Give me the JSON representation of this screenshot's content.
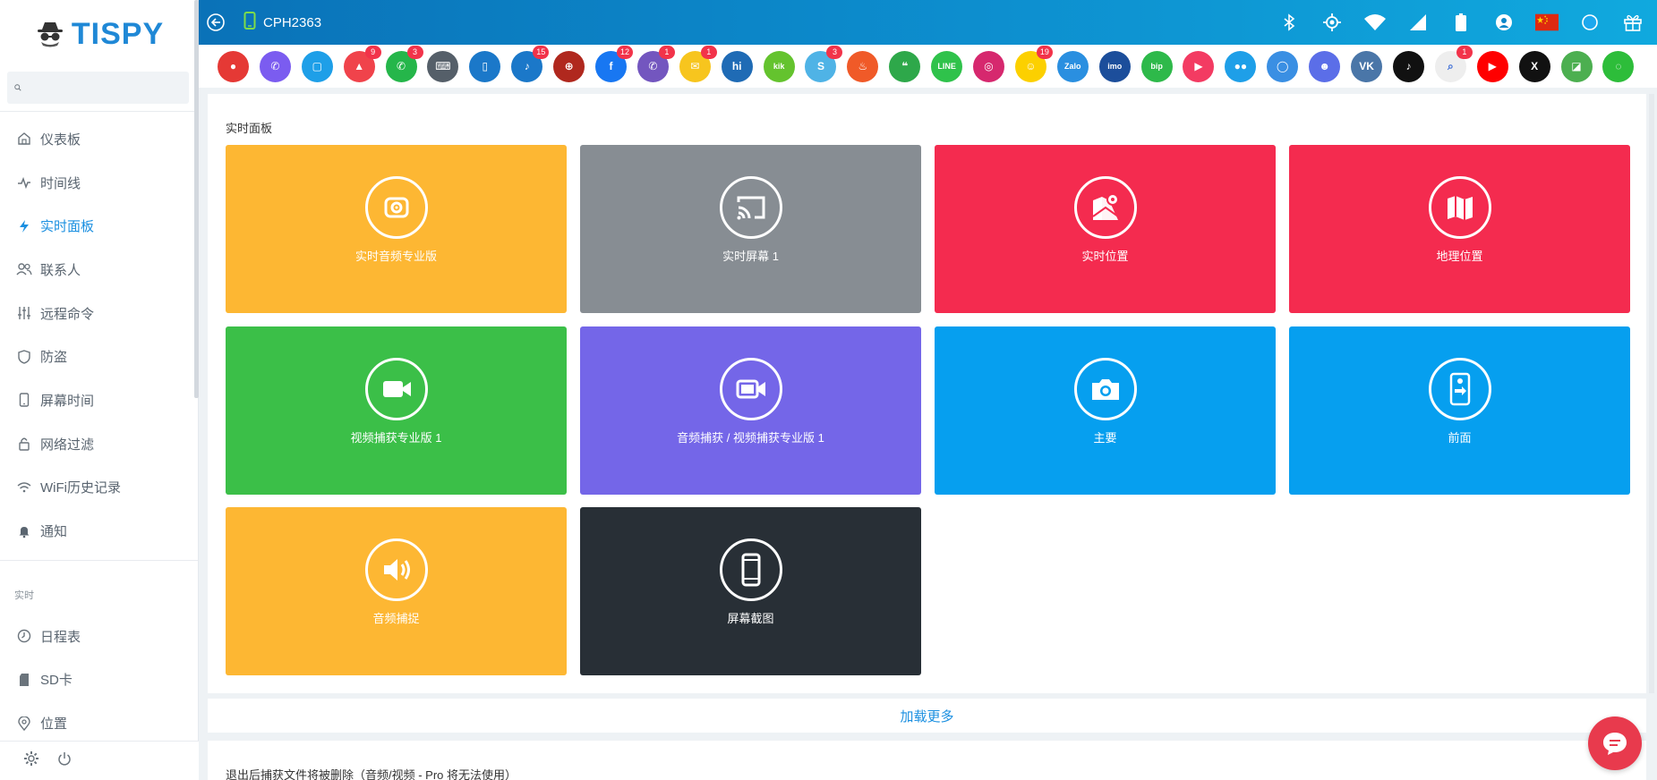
{
  "brand": {
    "name": "TISPY"
  },
  "search": {
    "placeholder": ""
  },
  "sidebar": {
    "items": [
      {
        "label": "仪表板",
        "icon": "home-icon"
      },
      {
        "label": "时间线",
        "icon": "pulse-icon"
      },
      {
        "label": "实时面板",
        "icon": "bolt-icon",
        "active": true
      },
      {
        "label": "联系人",
        "icon": "users-icon"
      },
      {
        "label": "远程命令",
        "icon": "sliders-icon"
      },
      {
        "label": "防盗",
        "icon": "shield-icon"
      },
      {
        "label": "屏幕时间",
        "icon": "phone-icon"
      },
      {
        "label": "网络过滤",
        "icon": "lock-icon"
      },
      {
        "label": "WiFi历史记录",
        "icon": "wifi-icon"
      },
      {
        "label": "通知",
        "icon": "bell-icon"
      }
    ],
    "section_label": "实时",
    "items2": [
      {
        "label": "日程表",
        "icon": "clock-icon"
      },
      {
        "label": "SD卡",
        "icon": "sdcard-icon"
      },
      {
        "label": "位置",
        "icon": "pin-icon"
      }
    ]
  },
  "topbar": {
    "device": "CPH2363"
  },
  "apps": [
    {
      "name": "video-recorder",
      "color": "#e53935",
      "glyph": "●"
    },
    {
      "name": "phone-calls",
      "color": "#7b5cf0",
      "glyph": "✆"
    },
    {
      "name": "sms",
      "color": "#1e9fe8",
      "glyph": "▢"
    },
    {
      "name": "gallery",
      "color": "#f0434b",
      "glyph": "▲",
      "badge": "9"
    },
    {
      "name": "whatsapp",
      "color": "#25b64a",
      "glyph": "✆",
      "badge": "3"
    },
    {
      "name": "keyboard",
      "color": "#555f69",
      "glyph": "⌨"
    },
    {
      "name": "device-info",
      "color": "#1b78c9",
      "glyph": "▯"
    },
    {
      "name": "notifications",
      "color": "#1b78c9",
      "glyph": "♪",
      "badge": "15"
    },
    {
      "name": "browser",
      "color": "#b0281e",
      "glyph": "⊕"
    },
    {
      "name": "facebook",
      "color": "#1877f2",
      "glyph": "f",
      "badge": "12"
    },
    {
      "name": "viber",
      "color": "#7356bf",
      "glyph": "✆",
      "badge": "1"
    },
    {
      "name": "email",
      "color": "#f7c51e",
      "glyph": "✉",
      "badge": "1"
    },
    {
      "name": "hike",
      "color": "#1f6bb5",
      "glyph": "hi"
    },
    {
      "name": "kik",
      "color": "#64c32e",
      "glyph": "kik"
    },
    {
      "name": "skype",
      "color": "#4fb3e6",
      "glyph": "S",
      "badge": "3"
    },
    {
      "name": "tinder",
      "color": "#f05a28",
      "glyph": "♨"
    },
    {
      "name": "hangouts",
      "color": "#2ea84a",
      "glyph": "❝"
    },
    {
      "name": "line",
      "color": "#2fc24b",
      "glyph": "LINE"
    },
    {
      "name": "instagram",
      "color": "#d6286e",
      "glyph": "◎"
    },
    {
      "name": "snapchat",
      "color": "#fcd000",
      "glyph": "☺",
      "badge": "19"
    },
    {
      "name": "zalo",
      "color": "#2a8fe0",
      "glyph": "Zalo"
    },
    {
      "name": "imo",
      "color": "#1c4e9b",
      "glyph": "imo"
    },
    {
      "name": "bip",
      "color": "#2eb94a",
      "glyph": "bip"
    },
    {
      "name": "camera-chat",
      "color": "#f33b62",
      "glyph": "▶"
    },
    {
      "name": "messenger-lite",
      "color": "#1e9fe8",
      "glyph": "●●"
    },
    {
      "name": "signal",
      "color": "#3a8fe3",
      "glyph": "◯"
    },
    {
      "name": "discord",
      "color": "#5b6ee8",
      "glyph": "☻"
    },
    {
      "name": "vk",
      "color": "#4a76a8",
      "glyph": "VK"
    },
    {
      "name": "tiktok",
      "color": "#111111",
      "glyph": "♪"
    },
    {
      "name": "search",
      "color": "#eeeeee",
      "glyph": "⌕",
      "badge": "1"
    },
    {
      "name": "youtube",
      "color": "#ff0000",
      "glyph": "▶"
    },
    {
      "name": "x-twitter",
      "color": "#111111",
      "glyph": "X"
    },
    {
      "name": "maps",
      "color": "#4caf50",
      "glyph": "◪"
    },
    {
      "name": "wechat",
      "color": "#2dbd3a",
      "glyph": "◌"
    }
  ],
  "panel": {
    "title": "实时面板",
    "tiles": [
      {
        "label": "实时音频专业版",
        "color": "#fdb733",
        "icon": "live-audio-icon"
      },
      {
        "label": "实时屏幕 1",
        "color": "#878d93",
        "icon": "cast-screen-icon"
      },
      {
        "label": "实时位置",
        "color": "#f42b4f",
        "icon": "map-pin-icon"
      },
      {
        "label": "地理位置",
        "color": "#f42b4f",
        "icon": "map-icon"
      },
      {
        "label": "视频捕获专业版 1",
        "color": "#3bbf48",
        "icon": "video-camera-icon"
      },
      {
        "label": "音频捕获 / 视频捕获专业版 1",
        "color": "#7466e8",
        "icon": "video-capture-icon"
      },
      {
        "label": "主要",
        "color": "#069fef",
        "icon": "camera-icon"
      },
      {
        "label": "前面",
        "color": "#069fef",
        "icon": "front-camera-icon"
      },
      {
        "label": "音频捕捉",
        "color": "#fdb733",
        "icon": "speaker-icon"
      },
      {
        "label": "屏幕截图",
        "color": "#282f36",
        "icon": "smartphone-icon"
      }
    ]
  },
  "load_more": "加载更多",
  "note": "退出后捕获文件将被删除（音频/视频 - Pro 将无法使用）"
}
